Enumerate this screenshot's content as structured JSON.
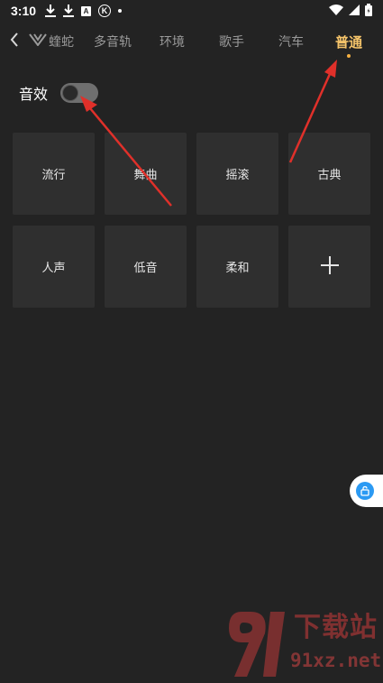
{
  "status_bar": {
    "time": "3:10",
    "icons": [
      "download-icon",
      "download-icon",
      "a-badge-icon",
      "k-circle-icon",
      "dot-icon"
    ],
    "a_badge": "A",
    "k_badge": "K",
    "right_icons": [
      "wifi-icon",
      "signal-icon",
      "battery-icon"
    ]
  },
  "tabs": {
    "items": [
      {
        "label": "蝰蛇",
        "icon": "viper-logo-icon"
      },
      {
        "label": "多音轨"
      },
      {
        "label": "环境"
      },
      {
        "label": "歌手"
      },
      {
        "label": "汽车"
      },
      {
        "label": "普通"
      }
    ],
    "active_index": 5,
    "active_color": "#f5c46a",
    "inactive_color": "#9a9a9a"
  },
  "effect": {
    "label": "音效",
    "enabled": false
  },
  "presets": [
    {
      "label": "流行"
    },
    {
      "label": "舞曲"
    },
    {
      "label": "摇滚"
    },
    {
      "label": "古典"
    },
    {
      "label": "人声"
    },
    {
      "label": "低音"
    },
    {
      "label": "柔和"
    },
    {
      "label": "",
      "icon": "plus-icon"
    }
  ],
  "floating_button": {
    "icon": "lock-icon",
    "color": "#2b9af3"
  },
  "annotations": {
    "arrow_color": "#e0302a"
  },
  "watermark": {
    "logo": "91-logo",
    "text_cn": "下载站",
    "url": "91xz.net"
  }
}
